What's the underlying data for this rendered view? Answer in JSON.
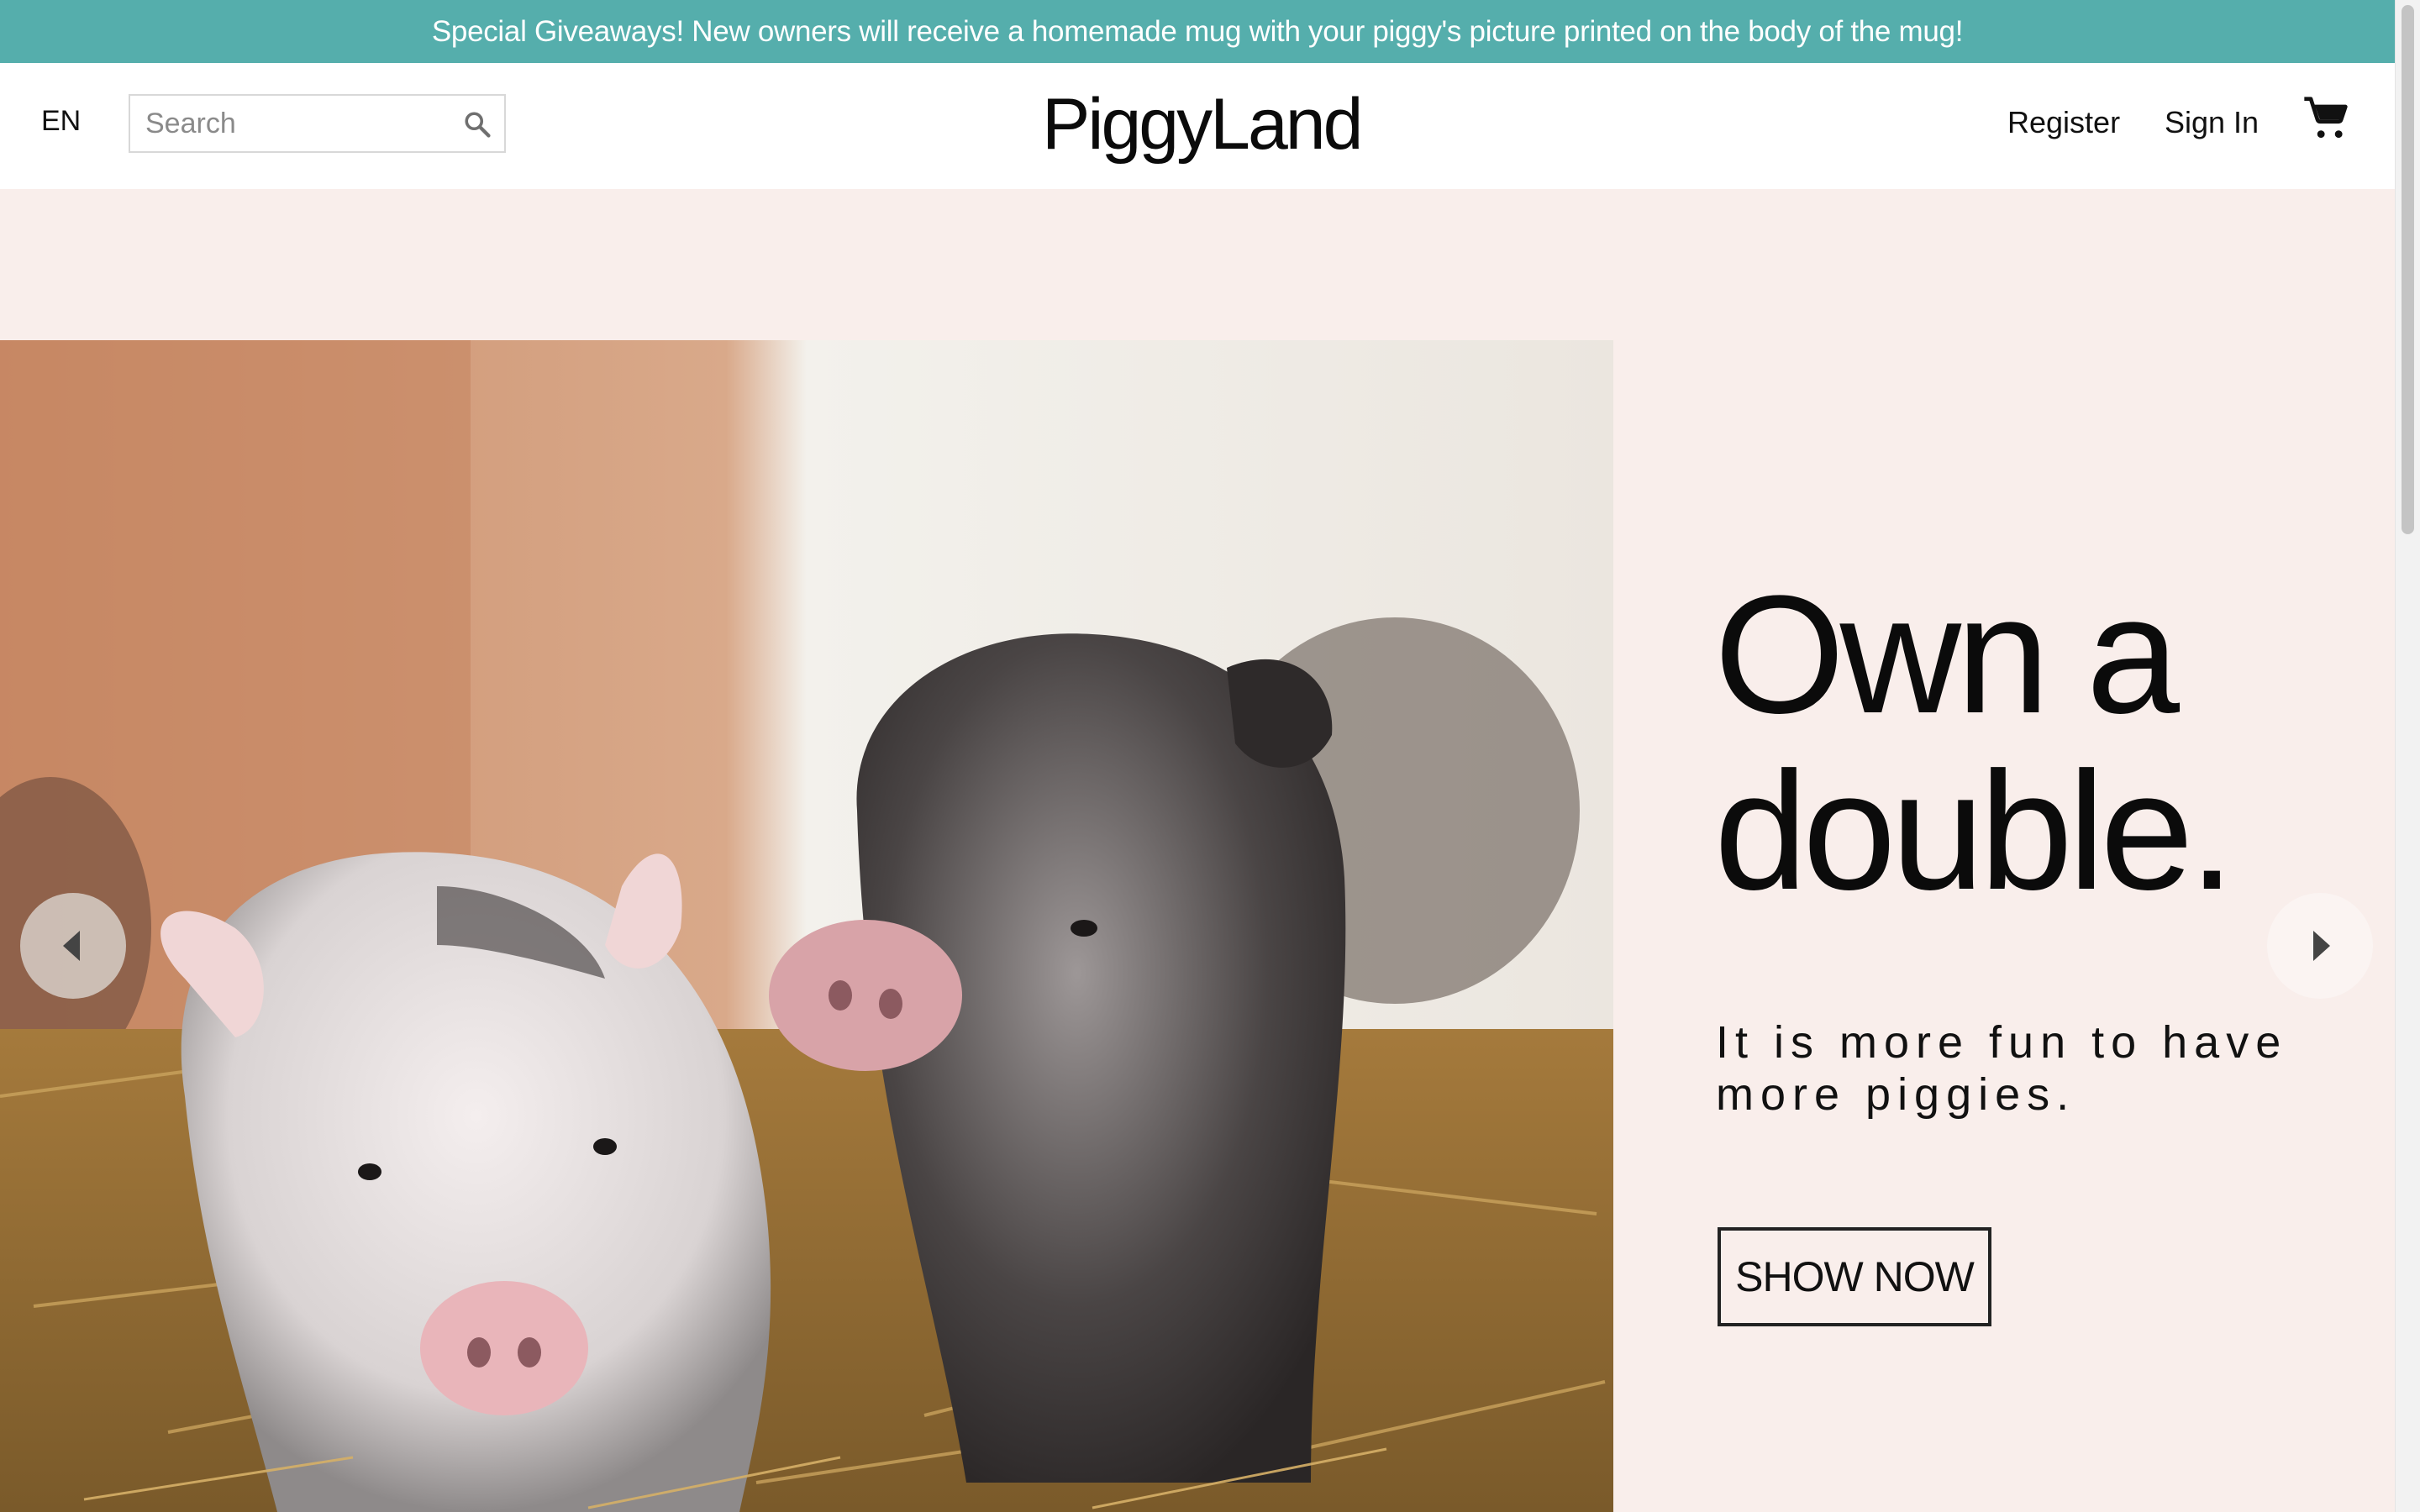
{
  "promo": {
    "text": "Special Giveaways! New owners will receive a homemade mug with your piggy's picture printed on the body of the mug!"
  },
  "header": {
    "language": "EN",
    "search_placeholder": "Search",
    "logo": "PiggyLand",
    "register": "Register",
    "sign_in": "Sign In"
  },
  "hero": {
    "headline": "Own a double.",
    "subline": "It is more fun to have more piggies.",
    "cta": "SHOW NOW"
  },
  "colors": {
    "promo_bg": "#55aeac",
    "hero_bg": "#f9eeeb",
    "text": "#111111"
  },
  "icons": {
    "search": "search-icon",
    "cart": "cart-icon",
    "prev": "chevron-left-icon",
    "next": "chevron-right-icon"
  }
}
